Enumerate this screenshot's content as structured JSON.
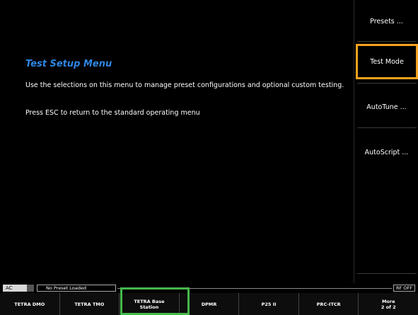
{
  "main": {
    "title": "Test Setup Menu",
    "description": "Use the selections on this menu to manage preset configurations and optional custom testing.",
    "esc_hint": "Press ESC to return to the standard operating menu"
  },
  "softkeys": [
    {
      "label": "Presets ...",
      "selected": false
    },
    {
      "label": "Test Mode",
      "selected": true
    },
    {
      "label": "AutoTune ...",
      "selected": false
    },
    {
      "label": "AutoScript ...",
      "selected": false
    }
  ],
  "status": {
    "power": "AC",
    "preset": "No Preset Loaded",
    "rf": "RF OFF"
  },
  "bottom_keys": [
    "TETRA DMO",
    "TETRA TMO",
    "TETRA Base\nStation",
    "DPMR",
    "P25 II",
    "PRC-ITCR",
    "More\n2 of 2"
  ],
  "colors": {
    "title": "#2f86e3",
    "selected_softkey": "#f5a21f",
    "highlight_frame": "#46b84a"
  }
}
